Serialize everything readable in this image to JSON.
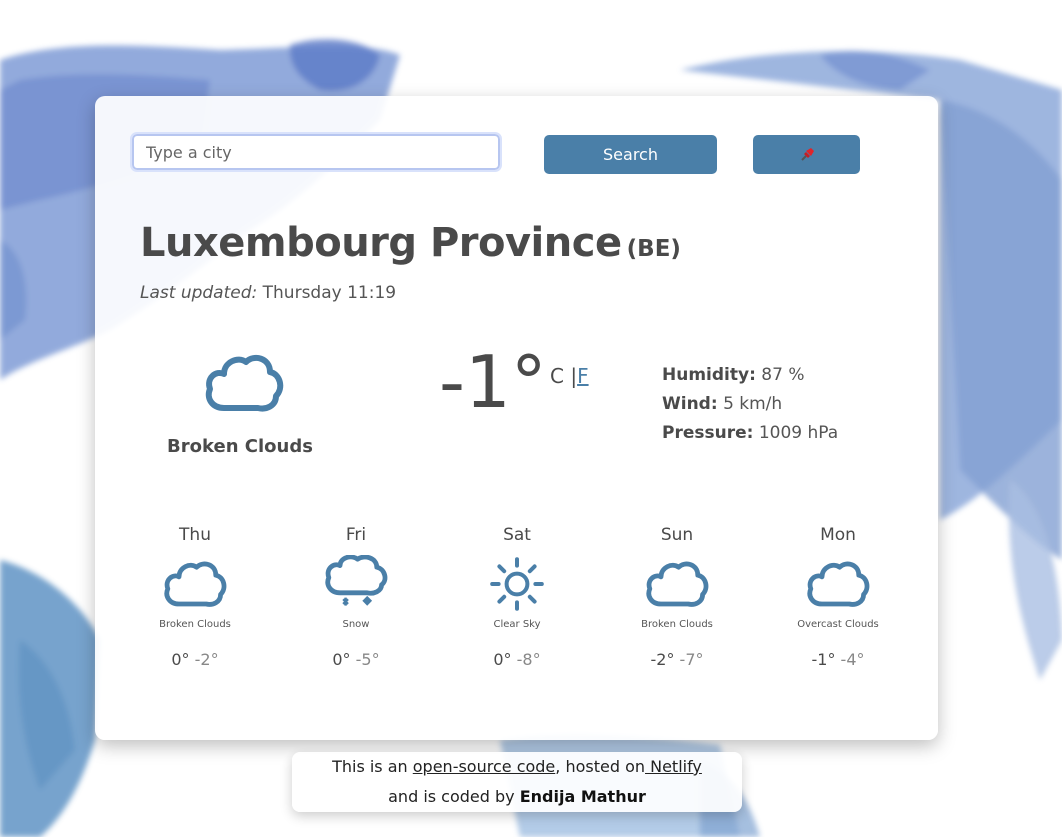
{
  "search": {
    "placeholder": "Type a city",
    "button_label": "Search",
    "location_icon": "pin-icon"
  },
  "current": {
    "city": "Luxembourg Province",
    "country": "(BE)",
    "updated_label": "Last updated:",
    "updated_value": "Thursday 11:19",
    "icon": "cloud-icon",
    "description": "Broken Clouds",
    "temperature": "-1°",
    "unit_c": "C",
    "unit_sep": "|",
    "unit_f": "F",
    "humidity_label": "Humidity:",
    "humidity_value": "87 %",
    "wind_label": "Wind:",
    "wind_value": "5 km/h",
    "pressure_label": "Pressure:",
    "pressure_value": "1009 hPa"
  },
  "forecast": [
    {
      "day": "Thu",
      "icon": "cloud-icon",
      "description": "Broken Clouds",
      "max": "0°",
      "min": "-2°"
    },
    {
      "day": "Fri",
      "icon": "snow-icon",
      "description": "Snow",
      "max": "0°",
      "min": "-5°"
    },
    {
      "day": "Sat",
      "icon": "sun-icon",
      "description": "Clear Sky",
      "max": "0°",
      "min": "-8°"
    },
    {
      "day": "Sun",
      "icon": "cloud-icon",
      "description": "Broken Clouds",
      "max": "-2°",
      "min": "-7°"
    },
    {
      "day": "Mon",
      "icon": "cloud-icon",
      "description": "Overcast Clouds",
      "max": "-1°",
      "min": "-4°"
    }
  ],
  "footer": {
    "text1": "This is an ",
    "link1": "open-source code",
    "text2": ", hosted on",
    "link2": " Netlify",
    "text3": "and is coded by ",
    "author": "Endija Mathur"
  },
  "colors": {
    "accent": "#4a7fa8",
    "map_blue": "#6f8fcf"
  }
}
